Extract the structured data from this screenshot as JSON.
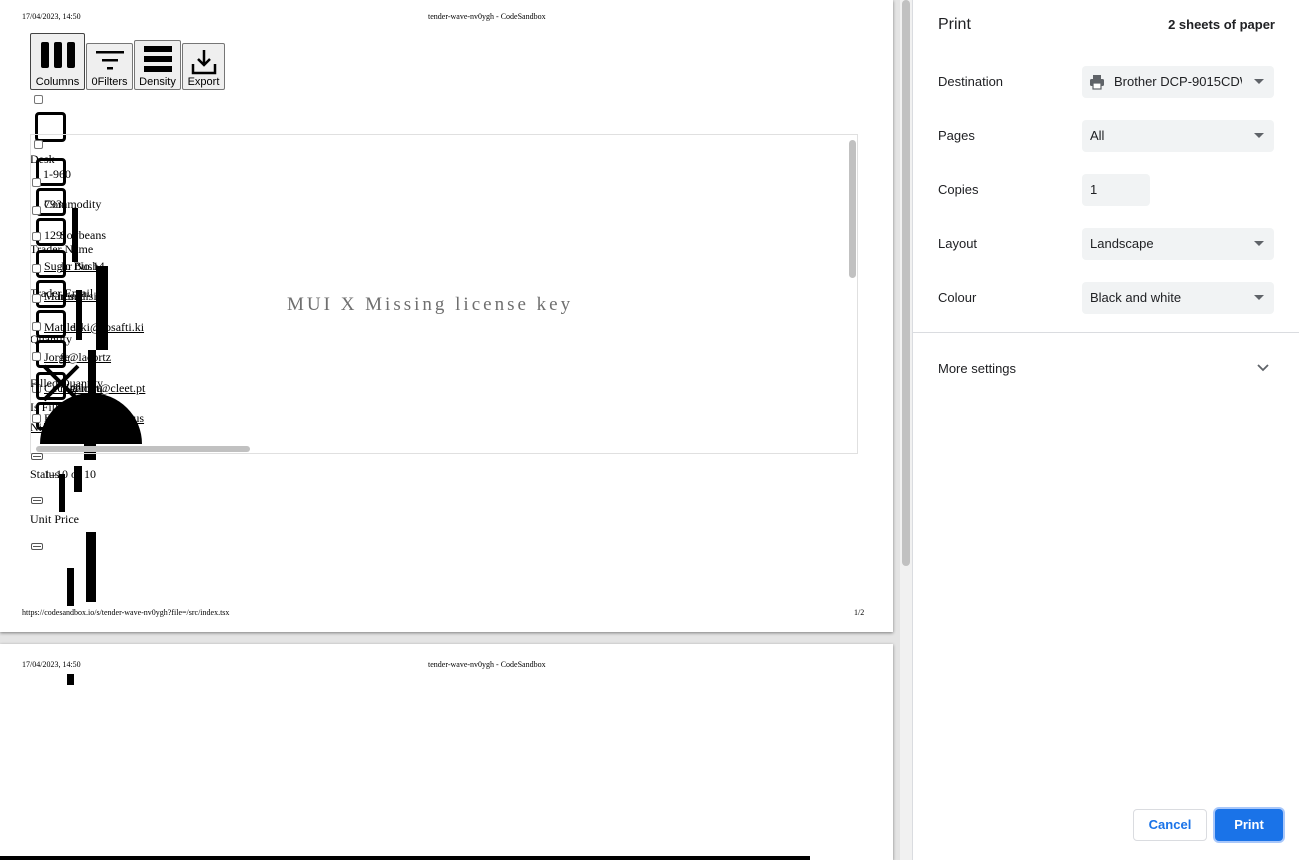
{
  "preview": {
    "page1": {
      "header_datetime": "17/04/2023, 14:50",
      "header_title": "tender-wave-nv0ygh - CodeSandbox",
      "footer_url": "https://codesandbox.io/s/tender-wave-nv0ygh?file=/src/index.tsx",
      "footer_page": "1/2"
    },
    "page2": {
      "header_datetime": "17/04/2023, 14:50",
      "header_title": "tender-wave-nv0ygh - CodeSandbox"
    },
    "toolbar": {
      "columns_label": "Columns",
      "filters_label": "0Filters",
      "density_label": "Density",
      "export_label": "Export"
    },
    "grid": {
      "column_headers": [
        "Desk",
        "Commodity",
        "Trader Name",
        "Trader Email",
        "Quantity",
        "Filled Quantity",
        "Is Filled",
        "Status",
        "Unit Price"
      ],
      "ids": [
        "1-960",
        "793",
        "129"
      ],
      "cells": [
        "Soybeans",
        "Sugar No.14",
        "Jo Bush",
        "Martina",
        "Matilda",
        "Jorge",
        "Cecilia",
        "Brayan",
        "Nico"
      ],
      "emails": [
        "hesedisi",
        "eaki@fosafti.ki",
        "fi@lacortz",
        "ni@lo.ru",
        "gamet@cleet.pt",
        "nutnul@wub.us"
      ],
      "pagination": "1–10 of 10",
      "watermark": "MUI X Missing license key"
    }
  },
  "print_panel": {
    "title": "Print",
    "sheets": "2 sheets of paper",
    "destination": {
      "label": "Destination",
      "value": "Brother DCP-9015CDW"
    },
    "pages": {
      "label": "Pages",
      "value": "All"
    },
    "copies": {
      "label": "Copies",
      "value": "1"
    },
    "layout": {
      "label": "Layout",
      "value": "Landscape"
    },
    "colour": {
      "label": "Colour",
      "value": "Black and white"
    },
    "more_settings": "More settings",
    "cancel": "Cancel",
    "print": "Print",
    "accent_color": "#1a73e8"
  }
}
